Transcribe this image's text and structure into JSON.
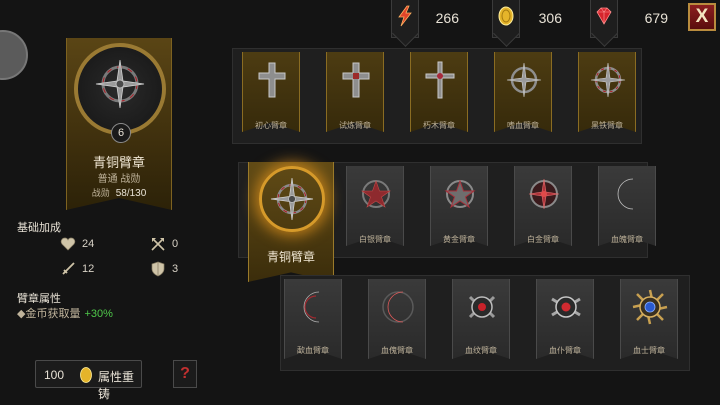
{
  "currency": {
    "energy": "266",
    "gold": "306",
    "gems": "679",
    "close_label": "X"
  },
  "selected": {
    "level": "6",
    "name": "青铜臂章",
    "tags": "普通 战勋",
    "exp_label": "战勋",
    "exp_value": "58/130"
  },
  "base_stats": {
    "title": "基础加成",
    "hp": "24",
    "attack_speed": "0",
    "attack": "12",
    "defense": "3"
  },
  "attributes": {
    "title": "臂章属性",
    "line_text": "◆金币获取量",
    "line_bonus": "+30%"
  },
  "reforge": {
    "cost": "100",
    "label": "属性重铸",
    "help": "?"
  },
  "row1": [
    {
      "label": "初心臂章"
    },
    {
      "label": "试炼臂章"
    },
    {
      "label": "朽木臂章"
    },
    {
      "label": "嗜血臂章"
    },
    {
      "label": "黑铁臂章"
    }
  ],
  "row2": {
    "selected_label": "青铜臂章",
    "items": [
      {
        "label": "白银臂章"
      },
      {
        "label": "黄金臂章"
      },
      {
        "label": "白金臂章"
      },
      {
        "label": "血魄臂章"
      }
    ]
  },
  "row3": [
    {
      "label": "歃血臂章"
    },
    {
      "label": "血傀臂章"
    },
    {
      "label": "血纹臂章"
    },
    {
      "label": "血仆臂章"
    },
    {
      "label": "血士臂章"
    }
  ],
  "colors": {
    "gold_frame": "#9a7a33",
    "selected_glow": "#d69a2a",
    "bonus_green": "#4fc84a",
    "close_red": "#8c1f1f"
  }
}
